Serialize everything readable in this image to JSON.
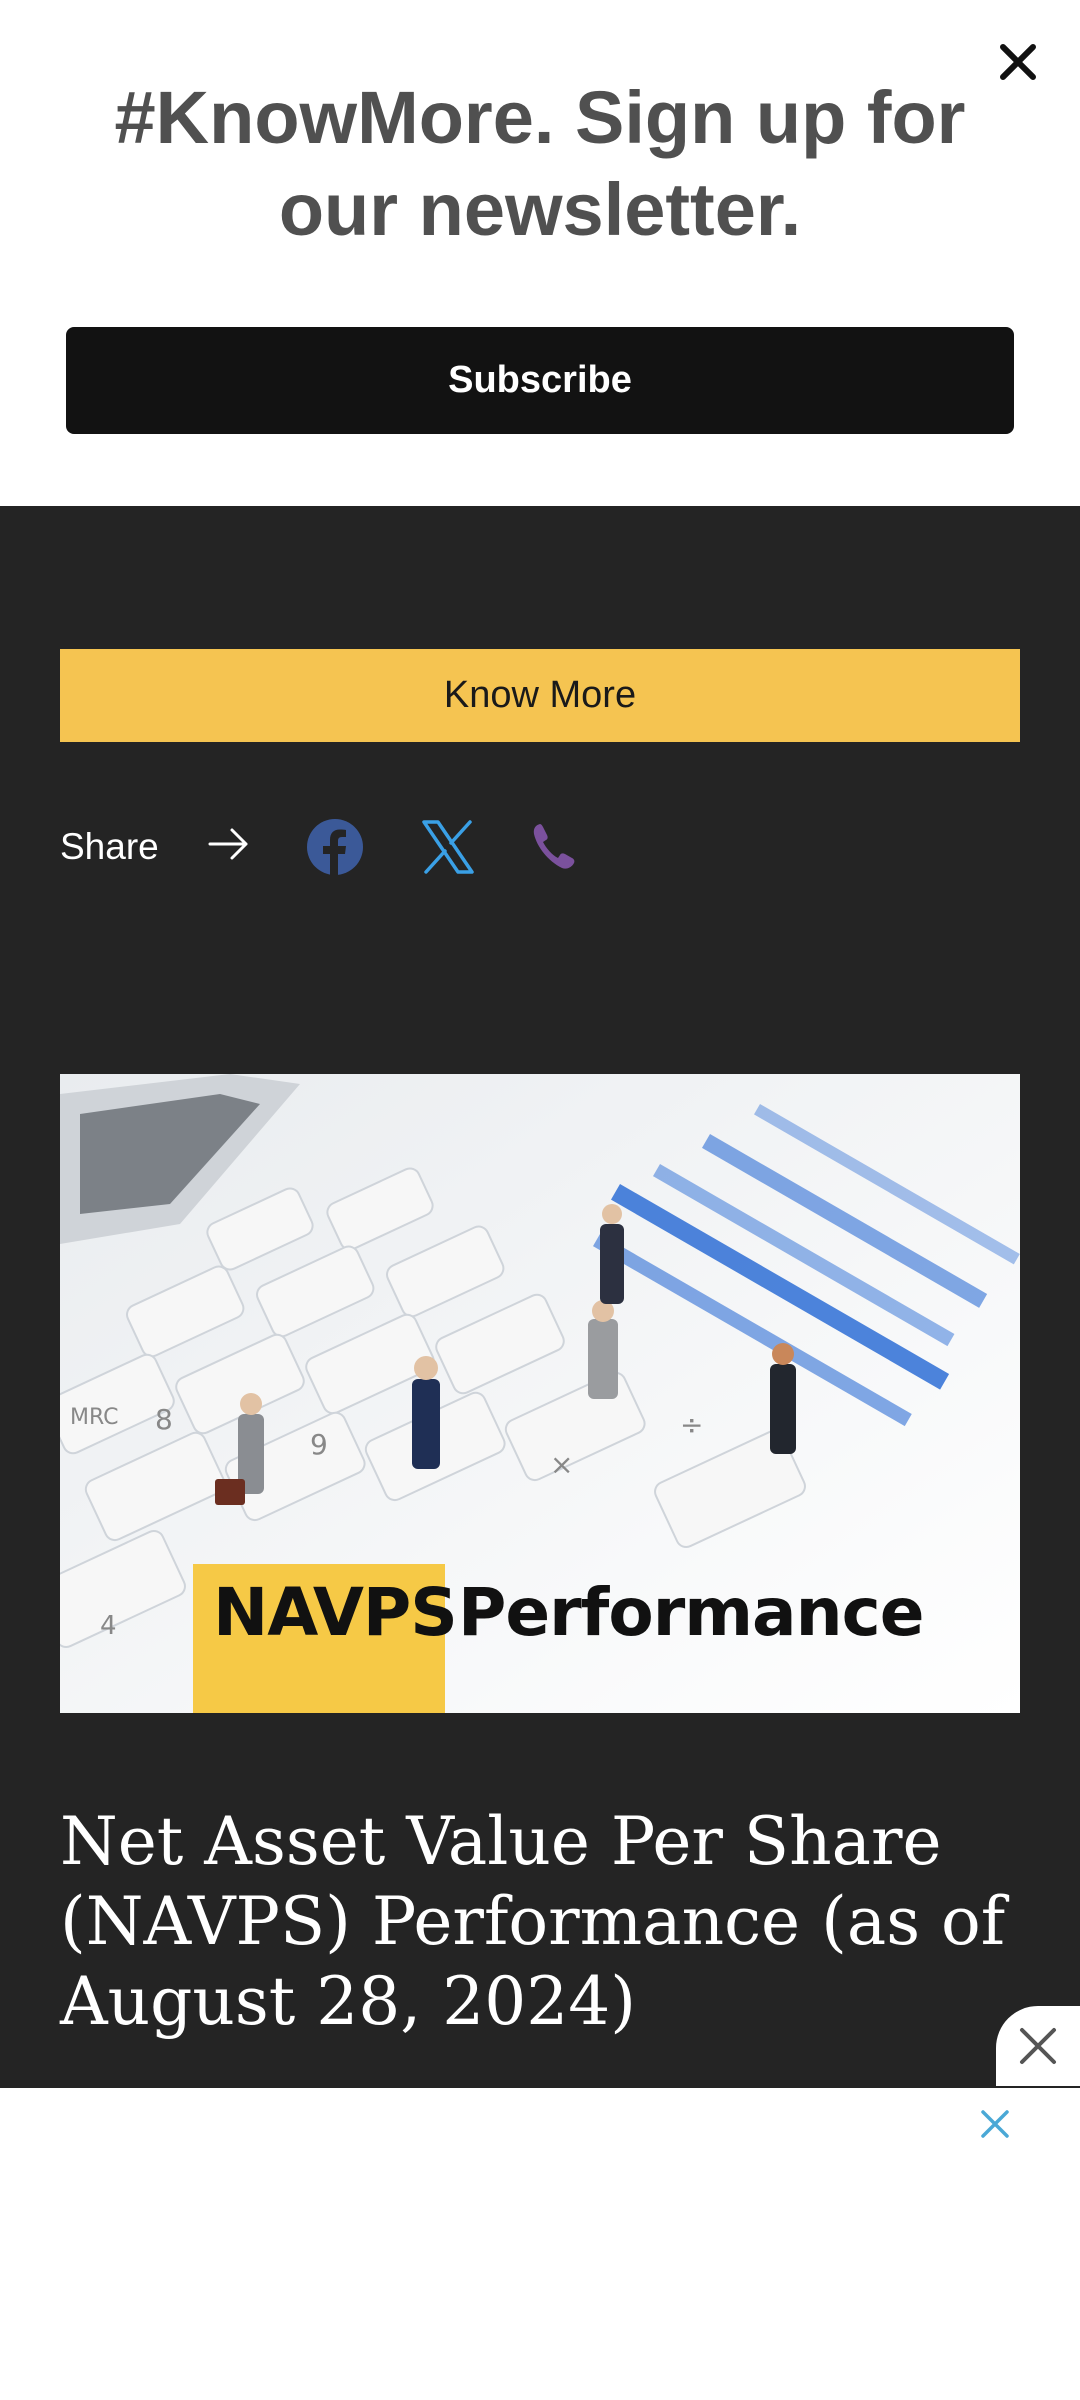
{
  "newsletter": {
    "title": "#KnowMore. Sign up for our newsletter.",
    "subscribe_label": "Subscribe",
    "close_icon": "close-icon"
  },
  "cta": {
    "know_more_label": "Know More"
  },
  "share": {
    "label": "Share",
    "icons": [
      "arrow-right-icon",
      "facebook-icon",
      "x-icon",
      "viber-icon"
    ]
  },
  "hero": {
    "label_left": "NAVPS",
    "label_right": "Performance"
  },
  "article": {
    "title": "Net Asset Value Per Share (NAVPS) Performance (as of August 28, 2024)"
  },
  "colors": {
    "background": "#242424",
    "accent_yellow": "#f5c451",
    "facebook": "#3b5998",
    "x_brand": "#3aa0e6",
    "viber": "#7b519d"
  }
}
